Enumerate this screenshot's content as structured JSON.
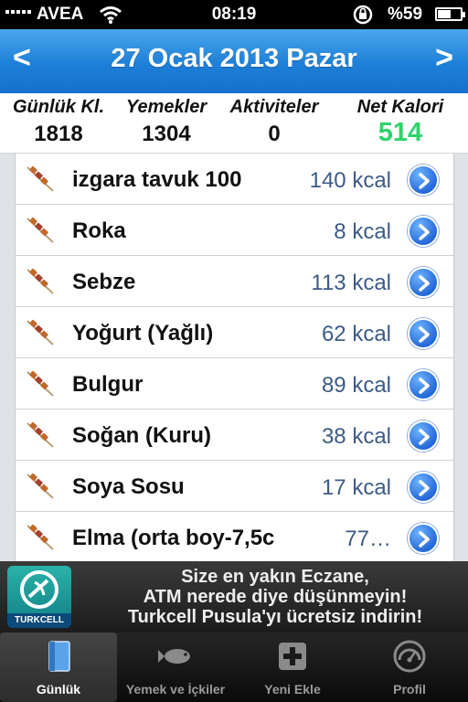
{
  "status_bar": {
    "carrier": "AVEA",
    "time": "08:19",
    "battery_percent": "%59",
    "battery_level": 0.59
  },
  "nav": {
    "title": "27 Ocak 2013 Pazar",
    "prev": "<",
    "next": ">"
  },
  "summary": [
    {
      "label": "Günlük Kl.",
      "value": "1818"
    },
    {
      "label": "Yemekler",
      "value": "1304"
    },
    {
      "label": "Aktiviteler",
      "value": "0"
    },
    {
      "label": "Net Kalori",
      "value": "514"
    }
  ],
  "foods": [
    {
      "name": "izgara tavuk 100",
      "kcal": "140 kcal"
    },
    {
      "name": "Roka",
      "kcal": "8 kcal"
    },
    {
      "name": "Sebze",
      "kcal": "113 kcal"
    },
    {
      "name": "Yoğurt (Yağlı)",
      "kcal": "62 kcal"
    },
    {
      "name": "Bulgur",
      "kcal": "89 kcal"
    },
    {
      "name": "Soğan (Kuru)",
      "kcal": "38 kcal"
    },
    {
      "name": "Soya Sosu",
      "kcal": "17 kcal"
    },
    {
      "name": "Elma (orta boy-7,5c",
      "kcal": "77…"
    }
  ],
  "banner": {
    "logo_text": "TURKCELL",
    "line1": "Size en yakın Eczane,",
    "line2": "ATM nerede diye düşünmeyin!",
    "line3": "Turkcell Pusula'yı ücretsiz indirin!"
  },
  "tabs": [
    {
      "label": "Günlük",
      "icon": "book-icon",
      "active": true
    },
    {
      "label": "Yemek ve İçkiler",
      "icon": "fish-icon",
      "active": false
    },
    {
      "label": "Yeni Ekle",
      "icon": "plus-icon",
      "active": false
    },
    {
      "label": "Profil",
      "icon": "speedometer-icon",
      "active": false
    }
  ],
  "colors": {
    "nav_blue": "#1d7fd8",
    "net_calorie_green": "#2fd36a",
    "kcal_text": "#3d5b86",
    "list_background": "#dfe3e8"
  }
}
